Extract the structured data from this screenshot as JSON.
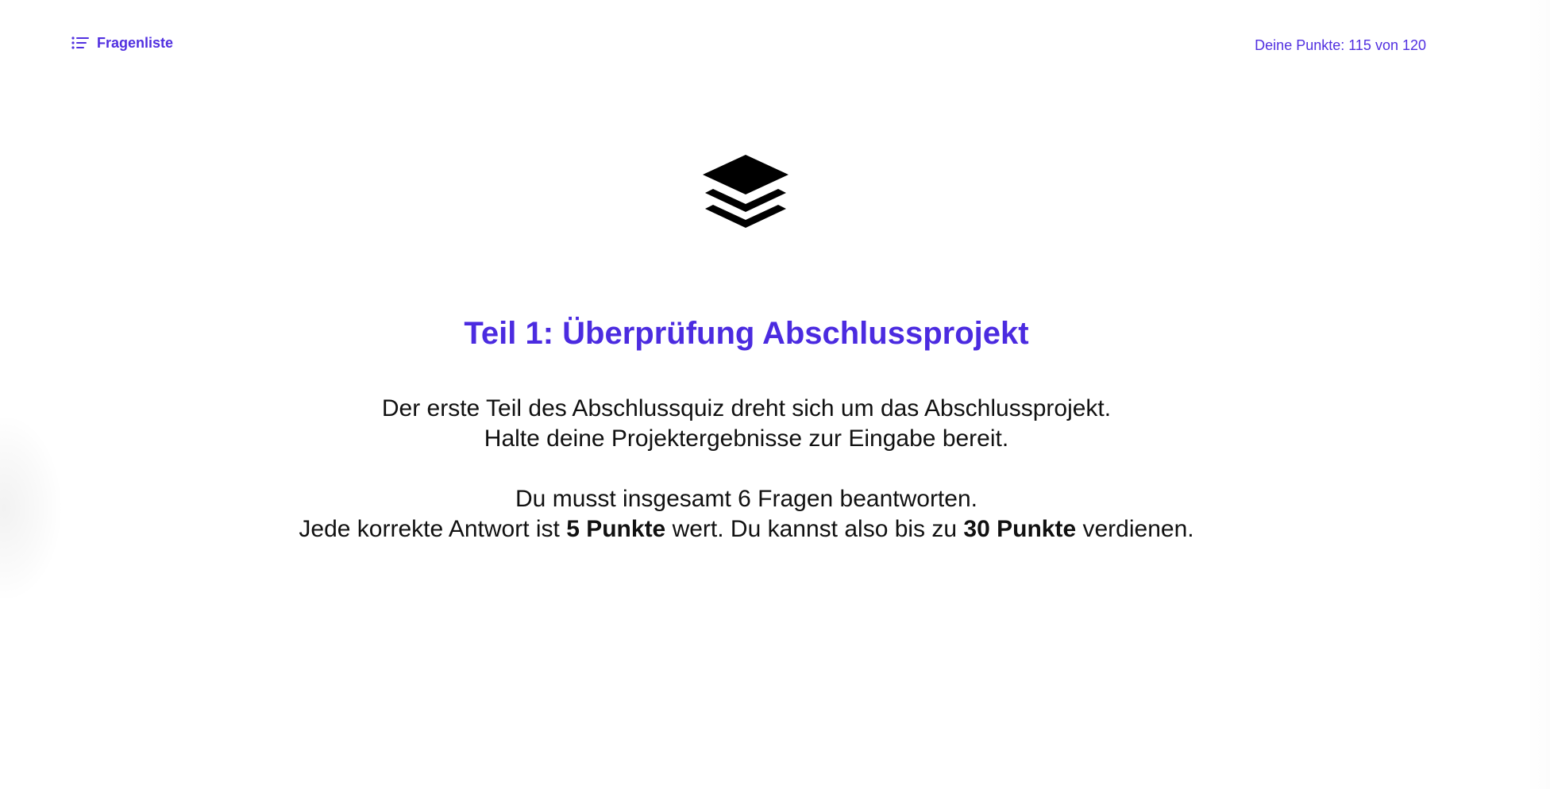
{
  "header": {
    "question_list_label": "Fragenliste",
    "score_text": "Deine Punkte: 115 von 120"
  },
  "icons": {
    "question_list_icon": "list-icon",
    "hero_icon": "layers-icon"
  },
  "main": {
    "title": "Teil 1: Überprüfung Abschlussprojekt",
    "intro_line_1": "Der erste Teil des Abschlussquiz dreht sich um das Abschlussprojekt.",
    "intro_line_2": "Halte deine Projektergebnisse zur Eingabe bereit.",
    "info_line_1": "Du musst insgesamt 6 Fragen beantworten.",
    "info_line_2_prefix": "Jede korrekte Antwort ist ",
    "points_per_answer": "5 Punkte",
    "info_line_2_middle": " wert. Du kannst also bis zu ",
    "max_points": "30 Punkte",
    "info_line_2_suffix": " verdienen."
  },
  "colors": {
    "accent": "#4b2be0",
    "text": "#111111",
    "background": "#ffffff"
  }
}
